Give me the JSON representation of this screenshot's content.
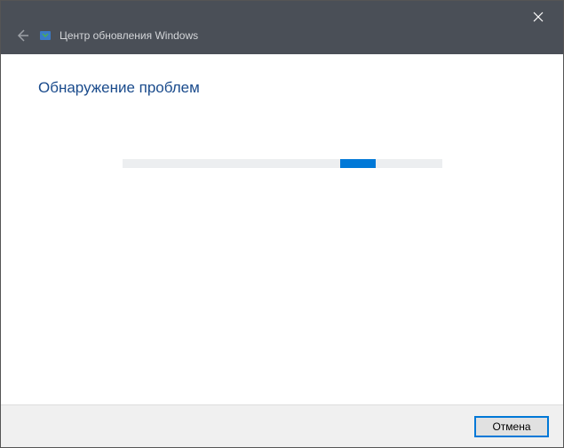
{
  "titlebar": {
    "title": "Центр обновления Windows"
  },
  "content": {
    "heading": "Обнаружение проблем"
  },
  "footer": {
    "cancel_label": "Отмена"
  },
  "colors": {
    "accent": "#0078d7",
    "titlebar_bg": "#4a4f57",
    "heading": "#1a4b8c"
  }
}
